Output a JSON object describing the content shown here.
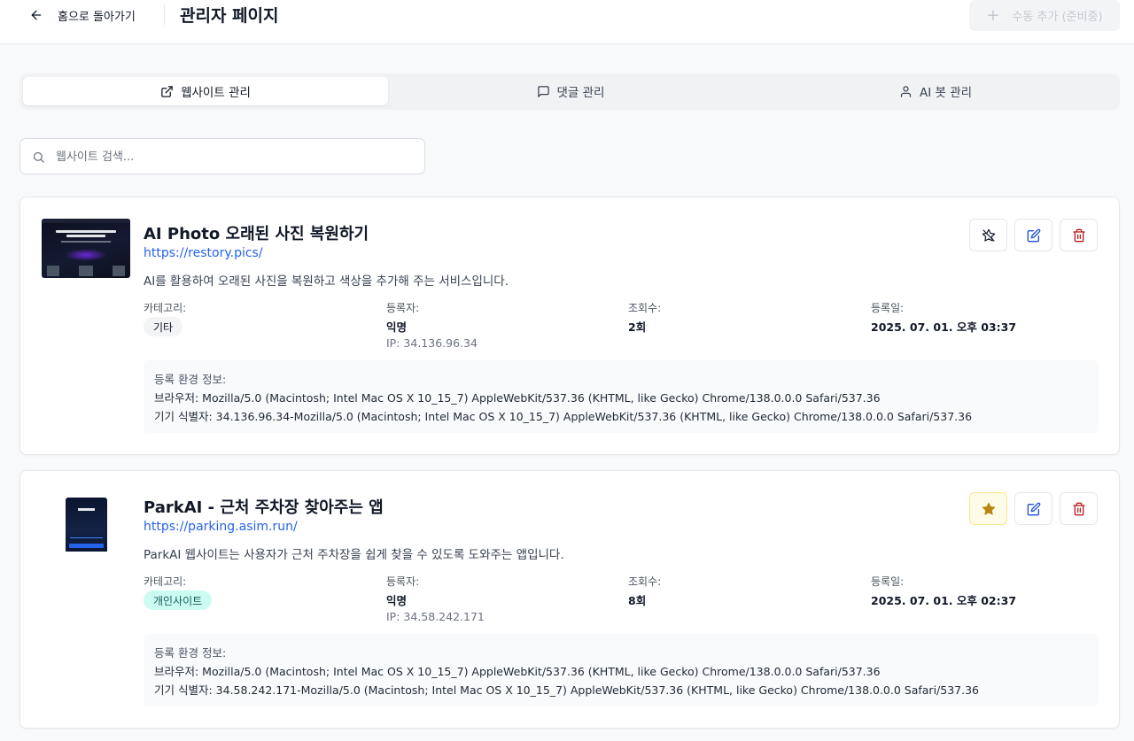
{
  "header": {
    "back_label": "홈으로 돌아가기",
    "title": "관리자 페이지",
    "manual_add_label": "수동 추가 (준비중)",
    "back_icon": "arrow-left-icon",
    "manual_add_icon": "plus-icon"
  },
  "tabs": [
    {
      "label": "웹사이트 관리",
      "icon": "external-link-icon",
      "active": true
    },
    {
      "label": "댓글 관리",
      "icon": "message-square-icon",
      "active": false
    },
    {
      "label": "AI 봇 관리",
      "icon": "user-icon",
      "active": false
    }
  ],
  "search": {
    "placeholder": "웹사이트 검색...",
    "value": "",
    "icon": "search-icon"
  },
  "labels": {
    "category": "카테고리:",
    "registrant": "등록자:",
    "views": "조회수:",
    "registered_at": "등록일:",
    "env_title": "등록 환경 정보:"
  },
  "websites": [
    {
      "name": "AI Photo 오래된 사진 복원하기",
      "url": "https://restory.pics/",
      "description": "AI를 활용하여 오래된 사진을 복원하고 색상을 추가해 주는 서비스입니다.",
      "category": "기타",
      "registrant": "익명",
      "ip": "IP: 34.136.96.34",
      "views": "2회",
      "date": "2025. 07. 01. 오후 03:37",
      "browser": "브라우저: Mozilla/5.0 (Macintosh; Intel Mac OS X 10_15_7) AppleWebKit/537.36 (KHTML, like Gecko) Chrome/138.0.0.0 Safari/537.36",
      "device_id": "기기 식별자: 34.136.96.34-Mozilla/5.0 (Macintosh; Intel Mac OS X 10_15_7) AppleWebKit/537.36 (KHTML, like Gecko) Chrome/138.0.0.0 Safari/537.36",
      "featured": false
    },
    {
      "name": "ParkAI - 근처 주차장 찾아주는 앱",
      "url": "https://parking.asim.run/",
      "description": "ParkAI 웹사이트는 사용자가 근처 주차장을 쉽게 찾을 수 있도록 도와주는 앱입니다.",
      "category": "개인사이트",
      "registrant": "익명",
      "ip": "IP: 34.58.242.171",
      "views": "8회",
      "date": "2025. 07. 01. 오후 02:37",
      "browser": "브라우저: Mozilla/5.0 (Macintosh; Intel Mac OS X 10_15_7) AppleWebKit/537.36 (KHTML, like Gecko) Chrome/138.0.0.0 Safari/537.36",
      "device_id": "기기 식별자: 34.58.242.171-Mozilla/5.0 (Macintosh; Intel Mac OS X 10_15_7) AppleWebKit/537.36 (KHTML, like Gecko) Chrome/138.0.0.0 Safari/537.36",
      "featured": true
    }
  ],
  "colors": {
    "link": "#2563eb",
    "star": "#b8860b",
    "edit": "#1d4ed8",
    "delete": "#b91c1c",
    "badge_teal_bg": "#ccfbf1"
  }
}
